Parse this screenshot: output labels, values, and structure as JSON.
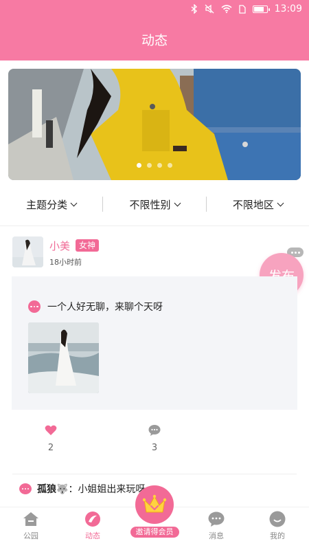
{
  "status_bar": {
    "time": "13:09",
    "icons": [
      "bluetooth-icon",
      "mute-icon",
      "wifi-icon",
      "sim-icon",
      "battery-icon"
    ]
  },
  "header": {
    "title": "动态"
  },
  "banner": {
    "page_count": 4,
    "active_page": 1
  },
  "filters": [
    {
      "label": "主题分类",
      "icon": "chevron-down-icon"
    },
    {
      "label": "不限性别",
      "icon": "chevron-down-icon"
    },
    {
      "label": "不限地区",
      "icon": "chevron-down-icon"
    }
  ],
  "post": {
    "username": "小美",
    "badge": "女神",
    "time": "18小时前",
    "text": "一个人好无聊，来聊个天呀",
    "likes": "2",
    "comments": "3"
  },
  "fab": {
    "label": "发布"
  },
  "comment": {
    "author": "孤狼🐺",
    "separator": "：",
    "text": "小姐姐出来玩呀"
  },
  "tabbar": {
    "items": [
      {
        "label": "公园",
        "icon": "park-icon",
        "active": false
      },
      {
        "label": "动态",
        "icon": "feed-icon",
        "active": true
      },
      {
        "label": "消息",
        "icon": "message-icon",
        "active": false
      },
      {
        "label": "我的",
        "icon": "profile-icon",
        "active": false
      }
    ],
    "invite_label": "邀请得会员"
  },
  "colors": {
    "brand": "#f77aa3",
    "accent": "#f26a96",
    "card_bg": "#f4f5f8"
  }
}
